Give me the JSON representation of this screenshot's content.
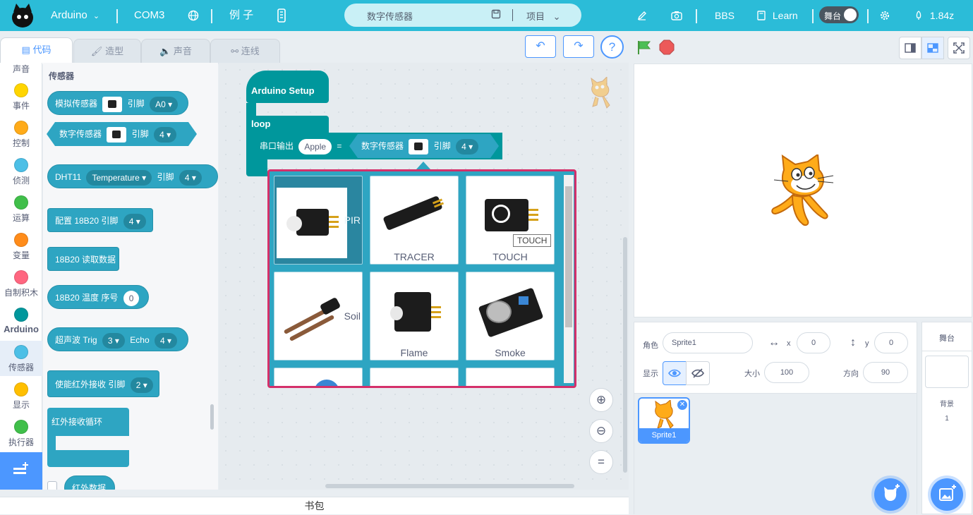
{
  "topbar": {
    "board": "Arduino",
    "port": "COM3",
    "examples": "例 子",
    "project_name": "数字传感器",
    "project_menu": "项目",
    "bbs": "BBS",
    "learn": "Learn",
    "stage_toggle": "舞台",
    "version": "1.84z"
  },
  "tabs": {
    "code": "代码",
    "costume": "造型",
    "sound": "声音",
    "wiring": "连线"
  },
  "categories": [
    {
      "label": "声音",
      "color": "#cf63cf"
    },
    {
      "label": "事件",
      "color": "#ffd500"
    },
    {
      "label": "控制",
      "color": "#ffab19"
    },
    {
      "label": "侦测",
      "color": "#4cbfe6"
    },
    {
      "label": "运算",
      "color": "#40bf4a"
    },
    {
      "label": "变量",
      "color": "#ff8c1a"
    },
    {
      "label": "自制积木",
      "color": "#ff6680"
    },
    {
      "label": "Arduino",
      "color": "#00979c"
    },
    {
      "label": "传感器",
      "color": "#4cbfe6"
    },
    {
      "label": "显示",
      "color": "#ffbf00"
    },
    {
      "label": "执行器",
      "color": "#40bf4a"
    }
  ],
  "palette": {
    "section": "传感器",
    "analog": {
      "label": "模拟传感器",
      "pin_label": "引脚",
      "pin": "A0"
    },
    "digital": {
      "label": "数字传感器",
      "pin_label": "引脚",
      "pin": "4"
    },
    "dht": {
      "label": "DHT11",
      "type": "Temperature",
      "pin_label": "引脚",
      "pin": "4"
    },
    "ds_config": {
      "label": "配置 18B20 引脚",
      "pin": "4"
    },
    "ds_read": {
      "label": "18B20 读取数据"
    },
    "ds_temp": {
      "label": "18B20 温度 序号",
      "index": "0"
    },
    "ultrasonic": {
      "label": "超声波 Trig",
      "trig": "3",
      "echo_label": "Echo",
      "echo": "4"
    },
    "ir_enable": {
      "label": "使能红外接收 引脚",
      "pin": "2"
    },
    "ir_loop": {
      "label": "红外接收循环"
    },
    "ir_data": {
      "label": "红外数据"
    }
  },
  "script": {
    "setup": "Arduino Setup",
    "loop": "loop",
    "serial_label": "串口输出",
    "serial_value": "Apple",
    "equals": "=",
    "sensor_label": "数字传感器",
    "pin_label": "引脚",
    "pin": "4"
  },
  "popup": {
    "cards": [
      {
        "label": "PIR",
        "selected": true
      },
      {
        "label": "TRACER",
        "selected": false
      },
      {
        "label": "TOUCH",
        "selected": false
      },
      {
        "label": "Soil",
        "selected": false
      },
      {
        "label": "Flame",
        "selected": false
      },
      {
        "label": "Smoke",
        "selected": false
      }
    ],
    "tooltip": "TOUCH"
  },
  "controls": {
    "help": "?"
  },
  "sprite": {
    "role_label": "角色",
    "name": "Sprite1",
    "x_label": "x",
    "x": "0",
    "y_label": "y",
    "y": "0",
    "show_label": "显示",
    "size_label": "大小",
    "size": "100",
    "direction_label": "方向",
    "direction": "90",
    "thumb_name": "Sprite1"
  },
  "stage_panel": {
    "title": "舞台",
    "backdrop_label": "背景",
    "backdrop_count": "1"
  },
  "bottom": {
    "backpack": "书包"
  }
}
